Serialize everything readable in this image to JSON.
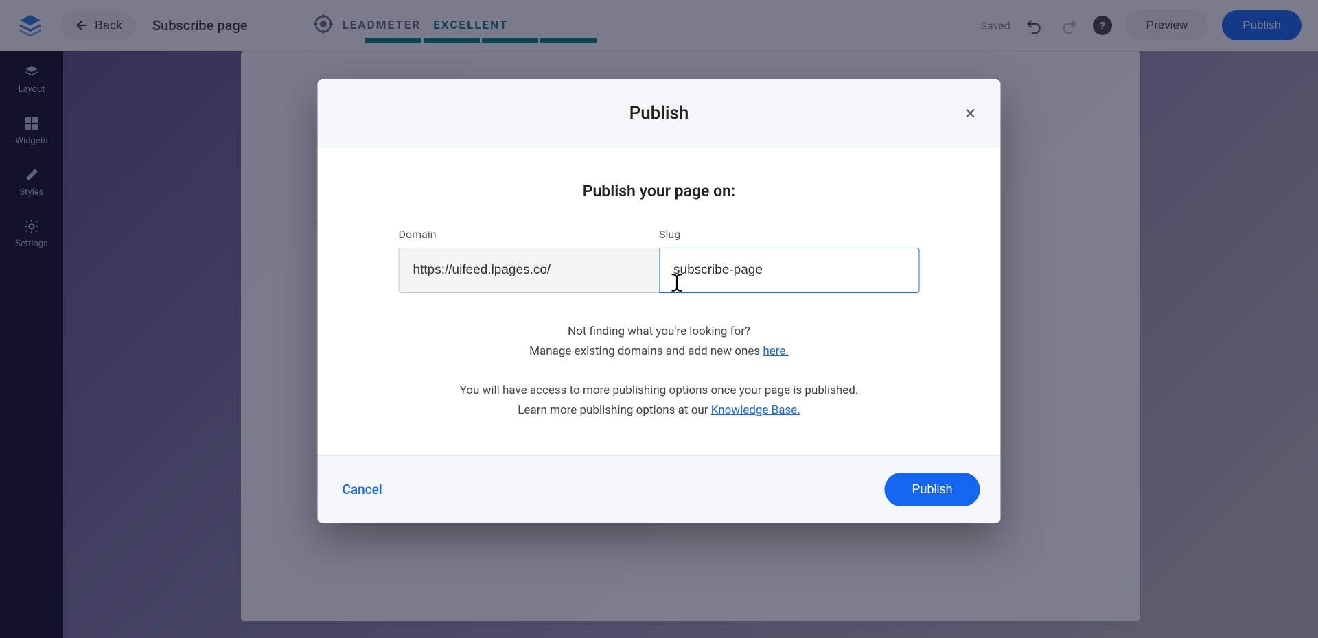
{
  "header": {
    "back_label": "Back",
    "page_title": "Subscribe page",
    "leadmeter_label": "LEADMETER",
    "leadmeter_rating": "EXCELLENT",
    "saved_label": "Saved",
    "preview_label": "Preview",
    "publish_label": "Publish"
  },
  "sidebar": {
    "items": [
      {
        "label": "Layout",
        "icon": "layers-icon"
      },
      {
        "label": "Widgets",
        "icon": "widgets-icon"
      },
      {
        "label": "Styles",
        "icon": "pencil-icon"
      },
      {
        "label": "Settings",
        "icon": "gear-icon"
      }
    ]
  },
  "modal": {
    "title": "Publish",
    "subtitle": "Publish your page on:",
    "domain_label": "Domain",
    "domain_value": "https://uifeed.lpages.co/",
    "slug_label": "Slug",
    "slug_value": "subscribe-page",
    "helper_line1": "Not finding what you're looking for?",
    "helper_line2a": "Manage existing domains and add new ones ",
    "helper_line2_link": "here.",
    "helper_line3": "You will have access to more publishing options once your page is published.",
    "helper_line4a": "Learn more publishing options at our ",
    "helper_line4_link": "Knowledge Base.",
    "cancel_label": "Cancel",
    "publish_label": "Publish"
  }
}
